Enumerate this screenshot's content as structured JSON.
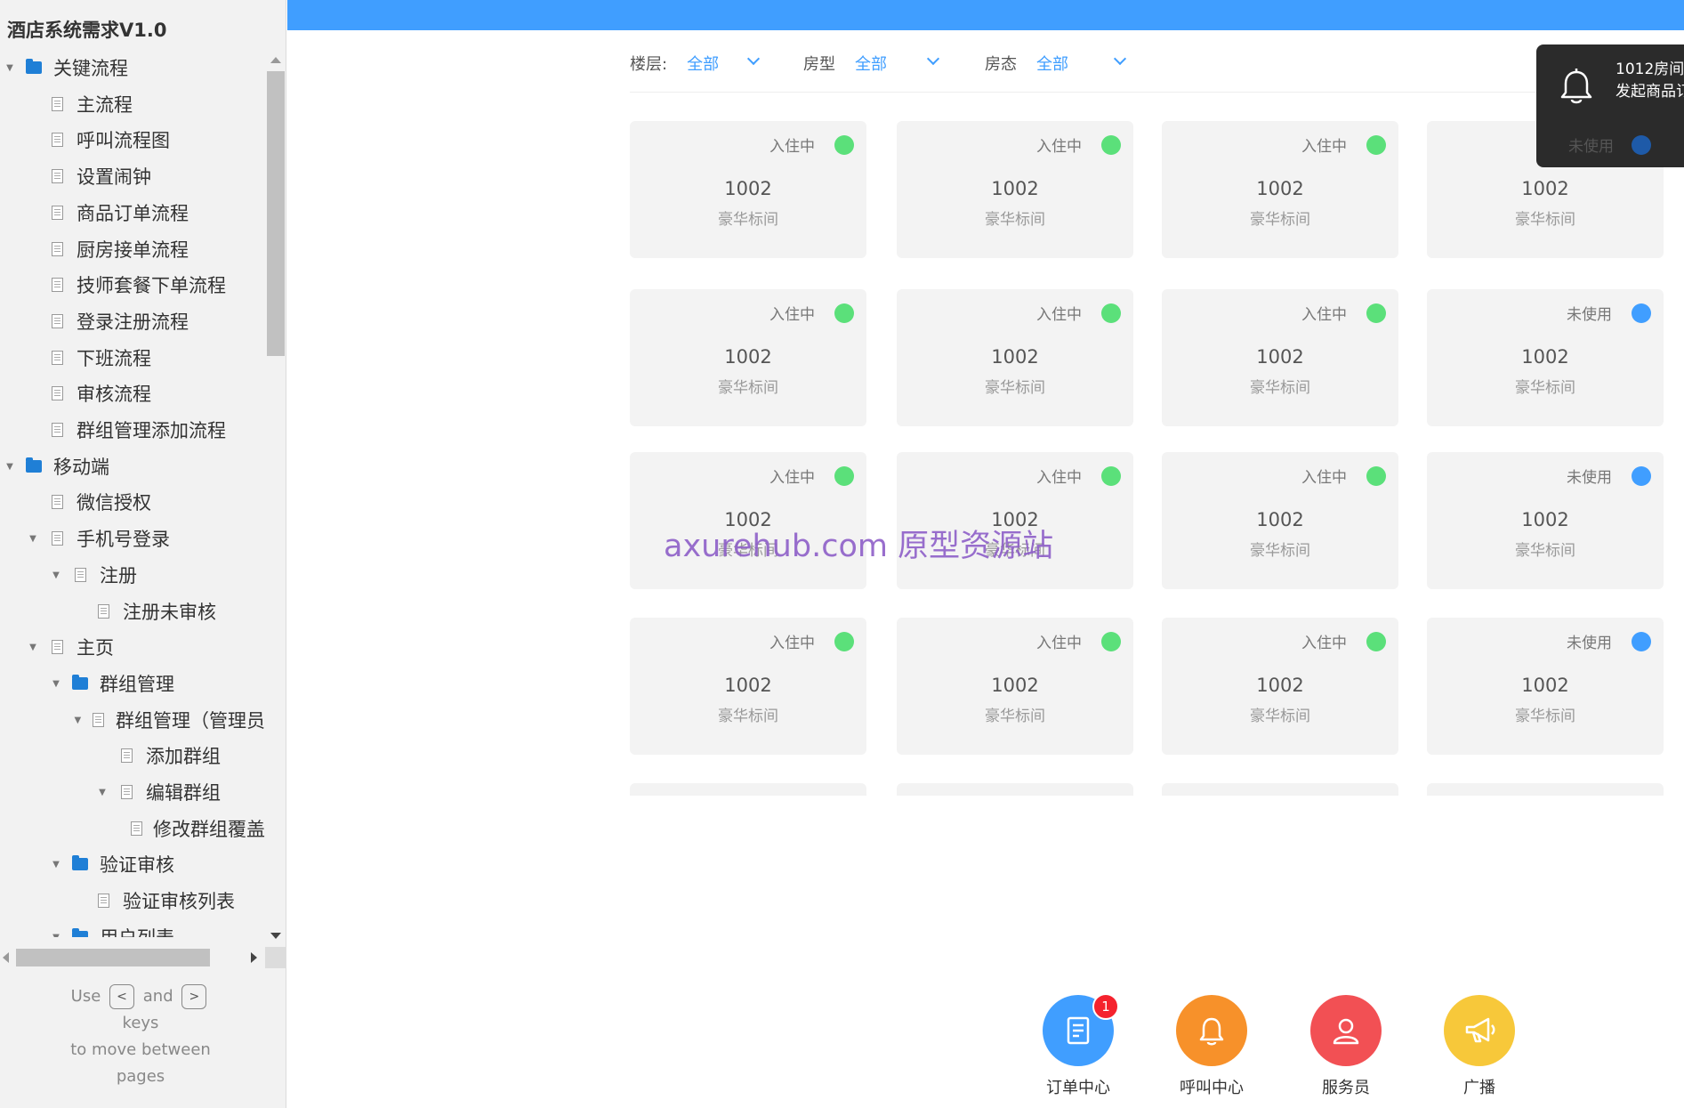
{
  "sidebar": {
    "title": "酒店系统需求V1.0",
    "tree": [
      {
        "label": "关键流程",
        "icon": "folder-icon",
        "depth": 0,
        "expanded": true
      },
      {
        "label": "主流程",
        "icon": "page-icon",
        "depth": 1,
        "expanded": false
      },
      {
        "label": "呼叫流程图",
        "icon": "page-icon",
        "depth": 1,
        "expanded": false
      },
      {
        "label": "设置闹钟",
        "icon": "page-icon",
        "depth": 1,
        "expanded": false
      },
      {
        "label": "商品订单流程",
        "icon": "page-icon",
        "depth": 1,
        "expanded": false
      },
      {
        "label": "厨房接单流程",
        "icon": "page-icon",
        "depth": 1,
        "expanded": false
      },
      {
        "label": "技师套餐下单流程",
        "icon": "page-icon",
        "depth": 1,
        "expanded": false
      },
      {
        "label": "登录注册流程",
        "icon": "page-icon",
        "depth": 1,
        "expanded": false
      },
      {
        "label": "下班流程",
        "icon": "page-icon",
        "depth": 1,
        "expanded": false
      },
      {
        "label": "审核流程",
        "icon": "page-icon",
        "depth": 1,
        "expanded": false
      },
      {
        "label": "群组管理添加流程",
        "icon": "page-icon",
        "depth": 1,
        "expanded": false
      },
      {
        "label": "移动端",
        "icon": "folder-icon",
        "depth": 0,
        "expanded": true
      },
      {
        "label": "微信授权",
        "icon": "page-icon",
        "depth": 1,
        "expanded": false
      },
      {
        "label": "手机号登录",
        "icon": "page-icon",
        "depth": 1,
        "expanded": true
      },
      {
        "label": "注册",
        "icon": "page-icon",
        "depth": 2,
        "expanded": true
      },
      {
        "label": "注册未审核",
        "icon": "page-icon",
        "depth": 3,
        "expanded": false
      },
      {
        "label": "主页",
        "icon": "page-icon",
        "depth": 1,
        "expanded": true
      },
      {
        "label": "群组管理",
        "icon": "folder-icon",
        "depth": 2,
        "expanded": true
      },
      {
        "label": "群组管理（管理员",
        "icon": "page-icon",
        "depth": 3,
        "expanded": true
      },
      {
        "label": "添加群组",
        "icon": "page-icon",
        "depth": 4,
        "expanded": false
      },
      {
        "label": "编辑群组",
        "icon": "page-icon",
        "depth": 4,
        "expanded": true
      },
      {
        "label": "修改群组覆盖",
        "icon": "page-icon",
        "depth": 5,
        "expanded": false
      },
      {
        "label": "验证审核",
        "icon": "folder-icon",
        "depth": 2,
        "expanded": true
      },
      {
        "label": "验证审核列表",
        "icon": "page-icon",
        "depth": 3,
        "expanded": false
      },
      {
        "label": "用户列表",
        "icon": "folder-icon",
        "depth": 2,
        "expanded": true
      }
    ],
    "keys_help": {
      "use": "Use",
      "key_prev": "<",
      "and": "and",
      "key_next": ">",
      "keys": "keys",
      "line2": "to move between",
      "line3": "pages"
    }
  },
  "colors": {
    "accent": "#409eff",
    "occupied": "#5be07a",
    "vacant": "#409eff"
  },
  "filters": {
    "floor": {
      "label": "楼层:",
      "value": "全部"
    },
    "room_type": {
      "label": "房型",
      "value": "全部"
    },
    "room_status": {
      "label": "房态",
      "value": "全部"
    }
  },
  "rooms": [
    {
      "status": "入住中",
      "state": "occupied",
      "number": "1002",
      "type": "豪华标间"
    },
    {
      "status": "入住中",
      "state": "occupied",
      "number": "1002",
      "type": "豪华标间"
    },
    {
      "status": "入住中",
      "state": "occupied",
      "number": "1002",
      "type": "豪华标间"
    },
    {
      "status": "",
      "state": "hidden",
      "number": "1002",
      "type": "豪华标间"
    },
    {
      "status": "入住中",
      "state": "occupied",
      "number": "1002",
      "type": "豪华标间"
    },
    {
      "status": "入住中",
      "state": "occupied",
      "number": "1002",
      "type": "豪华标间"
    },
    {
      "status": "入住中",
      "state": "occupied",
      "number": "1002",
      "type": "豪华标间"
    },
    {
      "status": "未使用",
      "state": "vacant",
      "number": "1002",
      "type": "豪华标间"
    },
    {
      "status": "入住中",
      "state": "occupied",
      "number": "1002",
      "type": "豪华标间"
    },
    {
      "status": "入住中",
      "state": "occupied",
      "number": "1002",
      "type": "豪华标间"
    },
    {
      "status": "入住中",
      "state": "occupied",
      "number": "1002",
      "type": "豪华标间"
    },
    {
      "status": "未使用",
      "state": "vacant",
      "number": "1002",
      "type": "豪华标间"
    },
    {
      "status": "入住中",
      "state": "occupied",
      "number": "1002",
      "type": "豪华标间"
    },
    {
      "status": "入住中",
      "state": "occupied",
      "number": "1002",
      "type": "豪华标间"
    },
    {
      "status": "入住中",
      "state": "occupied",
      "number": "1002",
      "type": "豪华标间"
    },
    {
      "status": "未使用",
      "state": "vacant",
      "number": "1002",
      "type": "豪华标间"
    }
  ],
  "notification": {
    "line1": "1012房间",
    "line2": "发起商品订",
    "underlying_status": "未使用"
  },
  "watermark": "axurehub.com 原型资源站",
  "actions": [
    {
      "label": "订单中心",
      "icon": "order-icon",
      "color": "#409eff",
      "badge": "1"
    },
    {
      "label": "呼叫中心",
      "icon": "bell-icon",
      "color": "#f7912a",
      "badge": ""
    },
    {
      "label": "服务员",
      "icon": "user-icon",
      "color": "#f25054",
      "badge": ""
    },
    {
      "label": "广播",
      "icon": "megaphone-icon",
      "color": "#f7c83a",
      "badge": ""
    }
  ]
}
